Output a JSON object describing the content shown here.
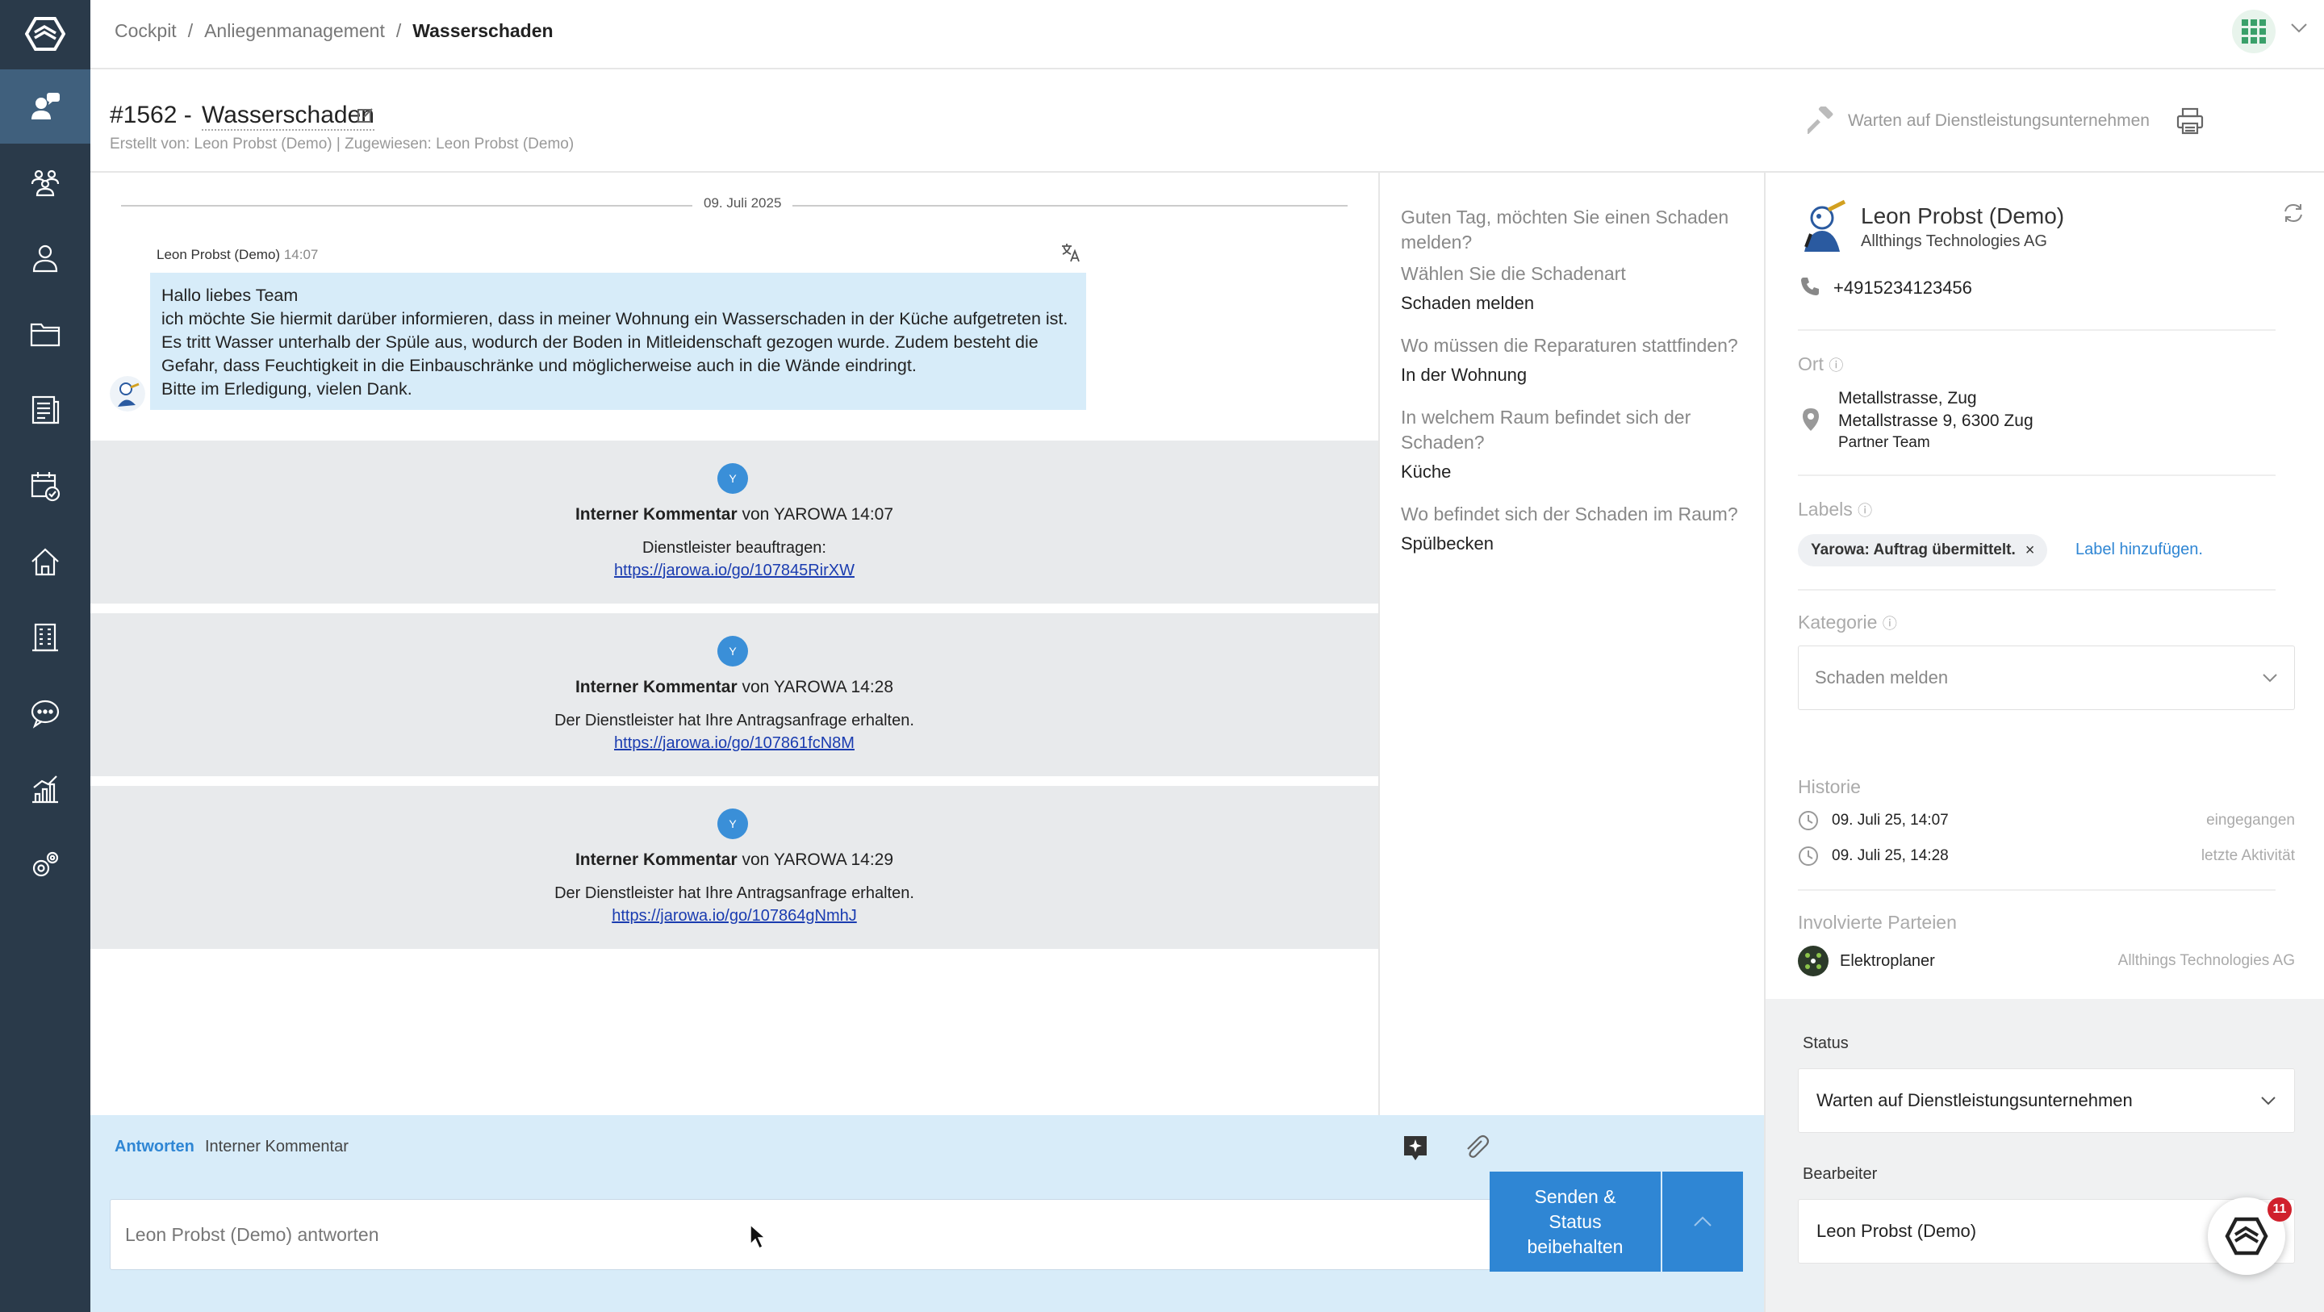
{
  "breadcrumb": {
    "items": [
      "Cockpit",
      "/",
      "Anliegenmanagement",
      "/",
      "Wasserschaden"
    ]
  },
  "header": {
    "number": "#1562 -",
    "title": "Wasserschaden",
    "subtitle": "Erstellt von: Leon Probst (Demo) | Zugewiesen: Leon Probst (Demo)",
    "status": "Warten auf Dienstleistungsunternehmen"
  },
  "sidebar": {
    "items": [
      "support-agent-icon",
      "community-icon",
      "person-icon",
      "folder-icon",
      "documents-icon",
      "calendar-check-icon",
      "home-icon",
      "building-icon",
      "chat-icon",
      "analytics-icon",
      "settings-icon"
    ],
    "active_color": "#40607d",
    "bg_color": "#2a3a4a"
  },
  "conversation": {
    "date": "09. Juli 2025",
    "message": {
      "author": "Leon Probst (Demo)",
      "time": "14:07",
      "lines": [
        "Hallo liebes Team",
        "ich möchte Sie hiermit darüber informieren, dass in meiner Wohnung ein Wasserschaden in der Küche aufgetreten ist.",
        "Es tritt Wasser unterhalb der Spüle aus, wodurch der Boden in Mitleidenschaft gezogen wurde. Zudem besteht die",
        "Gefahr, dass Feuchtigkeit in die Einbauschränke und möglicherweise auch in die Wände eindringt.",
        "Bitte im Erledigung, vielen Dank."
      ]
    },
    "internal_comments": [
      {
        "avatar": "Y",
        "title": "Interner Kommentar",
        "by": "von YAROWA 14:07",
        "text": "Dienstleister beauftragen:",
        "link": "https://jarowa.io/go/107845RirXW"
      },
      {
        "avatar": "Y",
        "title": "Interner Kommentar",
        "by": "von YAROWA 14:28",
        "text": "Der Dienstleister hat Ihre Antragsanfrage erhalten.",
        "link": "https://jarowa.io/go/107861fcN8M"
      },
      {
        "avatar": "Y",
        "title": "Interner Kommentar",
        "by": "von YAROWA 14:29",
        "text": "Der Dienstleister hat Ihre Antragsanfrage erhalten.",
        "link": "https://jarowa.io/go/107864gNmhJ"
      }
    ]
  },
  "reply": {
    "tab_reply": "Antworten",
    "tab_internal": "Interner Kommentar",
    "placeholder": "Leon Probst (Demo) antworten",
    "send_label": "Senden & Status beibehalten",
    "accent": "#2f86d4"
  },
  "qa": [
    {
      "q": "Guten Tag, möchten Sie einen Schaden melden?",
      "a": ""
    },
    {
      "q": "Wählen Sie die Schadenart",
      "a": "Schaden melden"
    },
    {
      "q": "Wo müssen die Reparaturen stattfinden?",
      "a": "In der Wohnung"
    },
    {
      "q": "In welchem Raum befindet sich der Schaden?",
      "a": "Küche"
    },
    {
      "q": "Wo befindet sich der Schaden im Raum?",
      "a": "Spülbecken"
    }
  ],
  "contact": {
    "name": "Leon Probst (Demo)",
    "company": "Allthings Technologies AG",
    "phone": "+4915234123456"
  },
  "location": {
    "label": "Ort",
    "lines": [
      "Metallstrasse, Zug",
      "Metallstrasse 9, 6300 Zug",
      "Partner Team"
    ]
  },
  "labels": {
    "label": "Labels",
    "chip": "Yarowa: Auftrag übermittelt.",
    "chip_close": "×",
    "add": "Label hinzufügen."
  },
  "category": {
    "label": "Kategorie",
    "value": "Schaden melden"
  },
  "history": {
    "label": "Historie",
    "rows": [
      {
        "date": "09. Juli 25, 14:07",
        "meta": "eingegangen"
      },
      {
        "date": "09. Juli 25, 14:28",
        "meta": "letzte Aktivität"
      }
    ]
  },
  "parties": {
    "label": "Involvierte Parteien",
    "rows": [
      {
        "name": "Elektroplaner",
        "company": "Allthings Technologies AG"
      }
    ]
  },
  "status": {
    "label": "Status",
    "value": "Warten auf Dienstleistungsunternehmen"
  },
  "editor": {
    "label": "Bearbeiter",
    "value": "Leon Probst (Demo)"
  },
  "notifications": {
    "count": "11"
  }
}
